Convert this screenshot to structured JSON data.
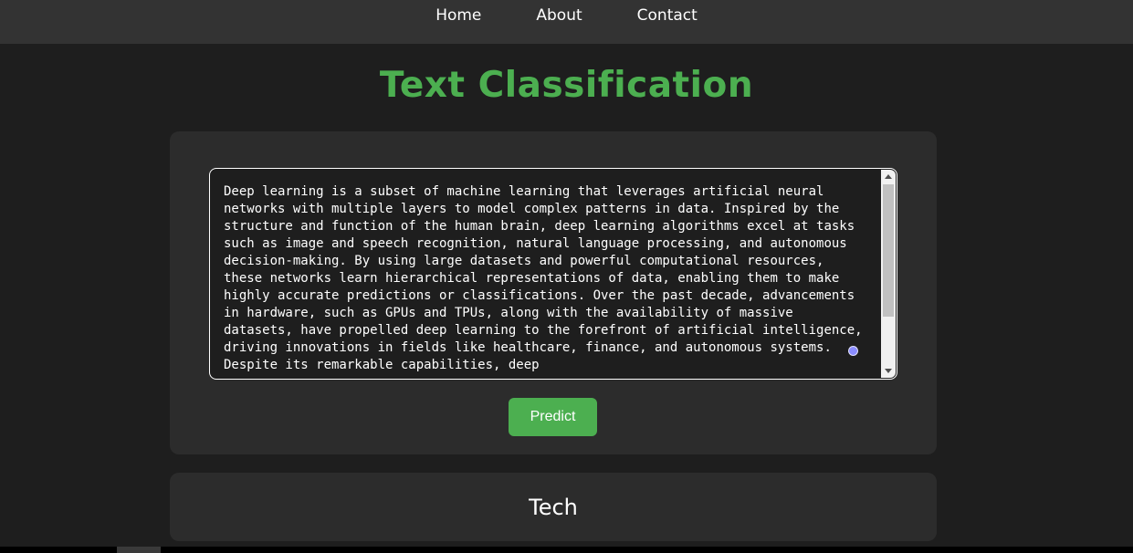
{
  "nav": {
    "links": [
      {
        "label": "Home"
      },
      {
        "label": "About"
      },
      {
        "label": "Contact"
      }
    ]
  },
  "page": {
    "title": "Text Classification"
  },
  "form": {
    "text_value": "Deep learning is a subset of machine learning that leverages artificial neural networks with multiple layers to model complex patterns in data. Inspired by the structure and function of the human brain, deep learning algorithms excel at tasks such as image and speech recognition, natural language processing, and autonomous decision-making. By using large datasets and powerful computational resources, these networks learn hierarchical representations of data, enabling them to make highly accurate predictions or classifications. Over the past decade, advancements in hardware, such as GPUs and TPUs, along with the availability of massive datasets, have propelled deep learning to the forefront of artificial intelligence, driving innovations in fields like healthcare, finance, and autonomous systems. Despite its remarkable capabilities, deep",
    "predict_label": "Predict"
  },
  "result": {
    "label": "Tech"
  },
  "colors": {
    "accent": "#4caf50",
    "background": "#1e1e1e",
    "navbar": "#333333",
    "card": "#2c2c2c"
  }
}
